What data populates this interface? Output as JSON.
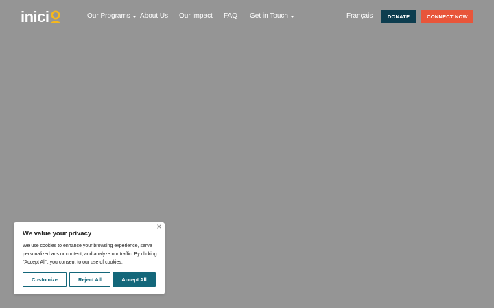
{
  "nav": {
    "logo_text": "inici",
    "logo_accent_color": "#f6b81b",
    "items": [
      {
        "label": "Our Programs",
        "has_dropdown": true
      },
      {
        "label": "About Us",
        "has_dropdown": false
      },
      {
        "label": "Our impact",
        "has_dropdown": false
      },
      {
        "label": "FAQ",
        "has_dropdown": false
      },
      {
        "label": "Get in Touch",
        "has_dropdown": true
      }
    ],
    "language": "Français",
    "donate_label": "DONATE",
    "connect_label": "CONNECT NOW"
  },
  "colors": {
    "overlay_bg": "#959595",
    "donate_bg": "#0d3d4f",
    "connect_bg": "#e8553a",
    "cookie_accent": "#13677a"
  },
  "cookie": {
    "title": "We value your privacy",
    "body": "We use cookies to enhance your browsing experience, serve personalized ads or content, and analyze our traffic. By clicking \"Accept All\", you consent to our use of cookies.",
    "close_icon": "close-icon",
    "customize_label": "Customize",
    "reject_label": "Reject All",
    "accept_label": "Accept All"
  }
}
